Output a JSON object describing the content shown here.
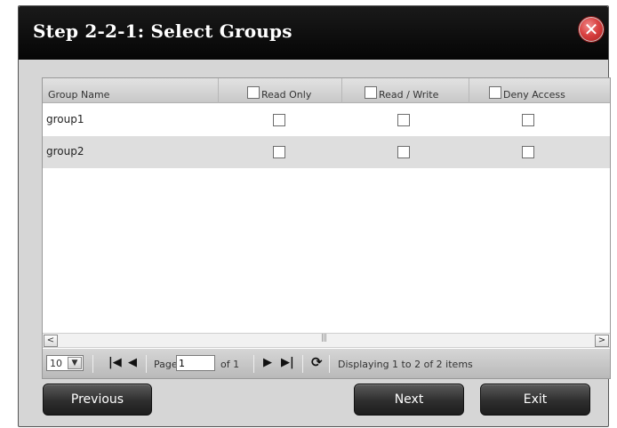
{
  "dialog": {
    "title": "Step 2-2-1: Select Groups",
    "close_icon": "close-icon"
  },
  "grid": {
    "columns": [
      {
        "label": "Group Name"
      },
      {
        "label": "Read Only"
      },
      {
        "label": "Read / Write"
      },
      {
        "label": "Deny Access"
      }
    ],
    "rows": [
      {
        "name": "group1"
      },
      {
        "name": "group2"
      }
    ]
  },
  "pager": {
    "page_size": "10",
    "page_label": "Page",
    "page_value": "1",
    "of_label": "of 1",
    "status": "Displaying 1 to 2 of 2 items"
  },
  "buttons": {
    "previous": "Previous",
    "next": "Next",
    "exit": "Exit"
  },
  "colors": {
    "titlebar": "#0a0a0a",
    "close": "#d84040",
    "button": "#2e2e2e"
  }
}
